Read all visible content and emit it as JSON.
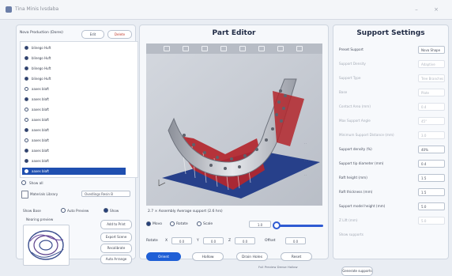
{
  "colors": {
    "accent": "#1f5fd6",
    "selection": "#1f4fb0",
    "model_silver": "#c9ccd3",
    "support_red": "#b3262c",
    "build_plate_blue": "#27408a"
  },
  "window": {
    "title": "Tina Minis lvsdaba",
    "icon": "app-icon",
    "minimize": "–",
    "close": "×"
  },
  "left_panel": {
    "header": "Nova Production (Dores)",
    "edit_label": "Edit",
    "delete_label": "Delete",
    "products": [
      {
        "label": "blinego Huft",
        "filled": true
      },
      {
        "label": "blinego Huft",
        "filled": true
      },
      {
        "label": "blinego Huft",
        "filled": true
      },
      {
        "label": "blinego Huft",
        "filled": true
      },
      {
        "label": "aaxes blaft",
        "filled": false
      },
      {
        "label": "aaxes blaft",
        "filled": true
      },
      {
        "label": "aaxes blaft",
        "filled": false
      },
      {
        "label": "aaxes blaft",
        "filled": false
      },
      {
        "label": "aaxes blaft",
        "filled": true
      },
      {
        "label": "aaxes blaft",
        "filled": false
      },
      {
        "label": "aaxes blaft",
        "filled": true
      },
      {
        "label": "aaxes blaft",
        "filled": true
      },
      {
        "label": "aaxes blaft",
        "filled": true,
        "selected": true
      }
    ],
    "option_row": "Show all",
    "material_label": "Materials Library",
    "material_value": "Ovedlings Resin B",
    "toggle_left": "Show Base",
    "toggle_right": "Auto Preview",
    "toggle_on": "Show",
    "preview_label": "Nearing preview",
    "buttons": [
      "Add to Print",
      "Export Scene",
      "Recalibrate",
      "Auto Arrange"
    ]
  },
  "center_panel": {
    "title": "Part Editor",
    "toolbar_icons": [
      "move-icon",
      "rotate-icon",
      "scale-icon",
      "mirror-icon",
      "cube-icon",
      "layers-icon",
      "measure-icon",
      "camera-icon"
    ],
    "status": "2.7 × Assembly Average support (2.6 hrs)",
    "mode_options": [
      "Movo",
      "Rotate",
      "Scale"
    ],
    "mode_selected": 0,
    "zoom_value": "1.0",
    "transform_label": "Rotate",
    "x_label": "X",
    "x_value": "0.0",
    "y_label": "Y",
    "y_value": "0.0",
    "z_label": "Z",
    "z_value": "0.0",
    "offset_label": "Offset",
    "offset_value": "0.0",
    "buttons": {
      "primary": "Orient",
      "second": "Hollow",
      "third": "Drain Holes",
      "fourth": "Reset"
    },
    "footer_text": "Full Preview Dense Hollow"
  },
  "right_panel": {
    "title": "Support Settings",
    "settings": [
      {
        "label": "Preset Support",
        "value": "Nova Shape",
        "dim": false
      },
      {
        "label": "Support Density",
        "value": "Adaptive",
        "dim": true
      },
      {
        "label": "Support Type",
        "value": "Tree Branches",
        "dim": true
      },
      {
        "label": "Base",
        "value": "Plate",
        "dim": true
      },
      {
        "label": "Contact Area (mm)",
        "value": "0.4",
        "dim": true
      },
      {
        "label": "Max Support Angle",
        "value": "45°",
        "dim": true
      },
      {
        "label": "Minimum Support Distance (mm)",
        "value": "3.0",
        "dim": true
      },
      {
        "label": "Support density (%)",
        "value": "40%",
        "dim": false
      },
      {
        "label": "Support tip diameter (mm)",
        "value": "0.4",
        "dim": false
      },
      {
        "label": "Raft height (mm)",
        "value": "1.5",
        "dim": false
      },
      {
        "label": "Raft thickness (mm)",
        "value": "1.5",
        "dim": false
      },
      {
        "label": "Support model height (mm)",
        "value": "5.0",
        "dim": false
      },
      {
        "label": "Z Lift (mm)",
        "value": "5.0",
        "dim": true
      },
      {
        "label": "Show supports",
        "value": "",
        "dim": true
      }
    ],
    "generate_label": "Generate supports"
  }
}
